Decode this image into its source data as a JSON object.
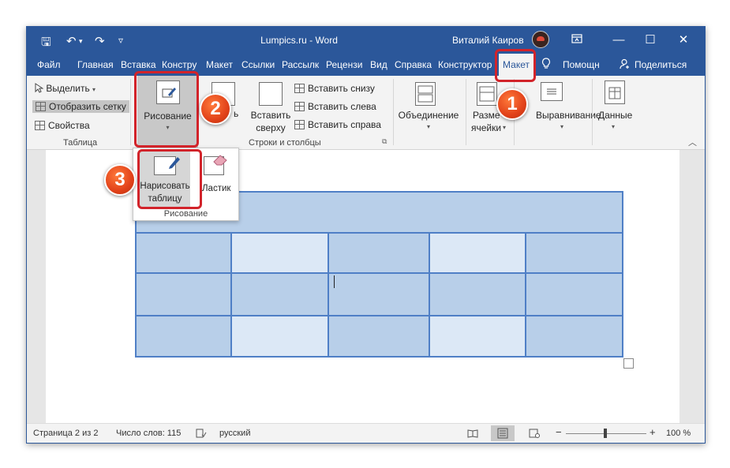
{
  "window": {
    "title": "Lumpics.ru  -  Word",
    "user": "Виталий Каиров",
    "buttons": {
      "restore_icon": "restore-icon",
      "minimize": "—",
      "maximize": "☐",
      "close": "✕"
    }
  },
  "quick_access": {
    "save": "🖫",
    "undo": "↶",
    "undo_caret": "▾",
    "redo": "↷",
    "customize": "▿"
  },
  "menu": {
    "tabs": [
      "Файл",
      "Главная",
      "Вставка",
      "Констру",
      "Макет",
      "Ссылки",
      "Рассылк",
      "Рецензи",
      "Вид",
      "Справка",
      "Конструктор",
      "Макет"
    ],
    "help": "Помощн",
    "share": "Поделиться"
  },
  "ribbon": {
    "table_group": {
      "select": "Выделить",
      "show_grid": "Отобразить сетку",
      "properties": "Свойства",
      "label": "Таблица"
    },
    "draw_group": {
      "label": "Рисование"
    },
    "delete_partial": "ь",
    "rows_group": {
      "insert_above_line1": "Вставить",
      "insert_above_line2": "сверху",
      "insert_below": "Вставить снизу",
      "insert_left": "Вставить слева",
      "insert_right": "Вставить справа",
      "label": "Строки и столбцы"
    },
    "merge": "Объединение",
    "cell_size_line1": "Разме",
    "cell_size_line2": "ячейки",
    "alignment": "Выравнивание",
    "data": "Данные"
  },
  "dropdown": {
    "draw_table_line1": "Нарисовать",
    "draw_table_line2": "таблицу",
    "eraser": "Ластик",
    "group_label": "Рисование"
  },
  "callouts": [
    "1",
    "2",
    "3"
  ],
  "status": {
    "page": "Страница 2 из 2",
    "words": "Число слов: 115",
    "language": "русский",
    "zoom": "100 %",
    "zoom_minus": "−",
    "zoom_plus": "+"
  },
  "colors": {
    "accent": "#2b579a",
    "cell_dark": "#b8cfe9",
    "cell_light": "#dce8f6",
    "highlight": "#d2232a",
    "badge": "#e2421a"
  }
}
